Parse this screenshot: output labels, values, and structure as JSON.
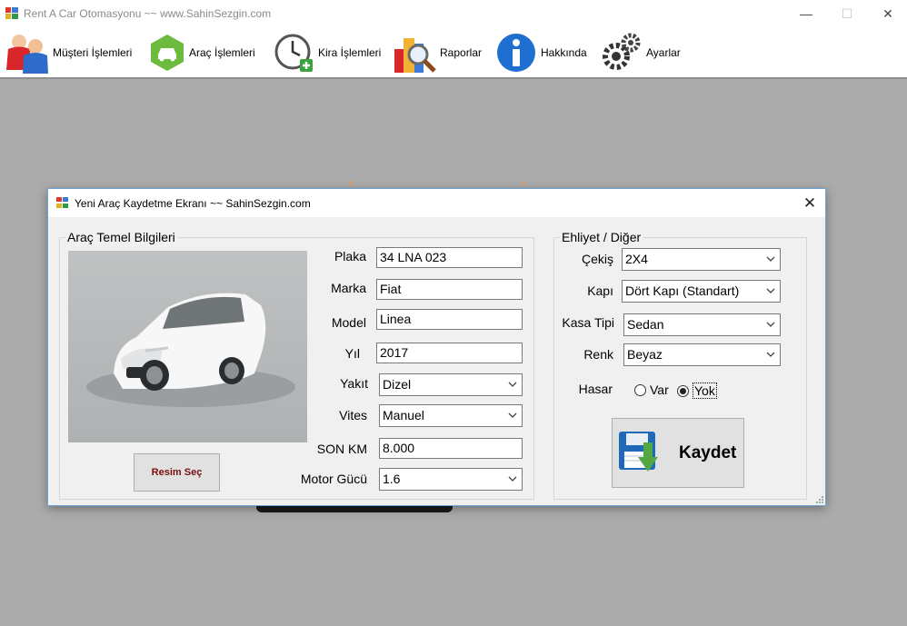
{
  "app": {
    "title": "Rent A Car Otomasyonu ~~ www.SahinSezgin.com",
    "window_controls": {
      "minimize": "—",
      "maximize": "☐",
      "close": "✕"
    }
  },
  "menu": {
    "items": [
      {
        "label": "Müşteri İşlemleri",
        "icon": "customers-icon"
      },
      {
        "label": "Araç İşlemleri",
        "icon": "car-icon"
      },
      {
        "label": "Kira İşlemleri",
        "icon": "clock-add-icon"
      },
      {
        "label": "Raporlar",
        "icon": "report-icon"
      },
      {
        "label": "Hakkında",
        "icon": "info-icon"
      },
      {
        "label": "Ayarlar",
        "icon": "gears-icon"
      }
    ]
  },
  "dialog": {
    "title": "Yeni Araç Kaydetme Ekranı ~~ SahinSezgin.com",
    "close": "✕",
    "basic_group": {
      "legend": "Araç Temel Bilgileri",
      "photo": "white Fiat Linea sedan photo",
      "select_image_button": "Resim Seç",
      "fields": {
        "plaka": {
          "label": "Plaka",
          "value": "34 LNA 023"
        },
        "marka": {
          "label": "Marka",
          "value": "Fiat"
        },
        "model": {
          "label": "Model",
          "value": "Linea"
        },
        "yil": {
          "label": "Yıl",
          "value": "2017"
        },
        "yakit": {
          "label": "Yakıt",
          "value": "Dizel"
        },
        "vites": {
          "label": "Vites",
          "value": "Manuel"
        },
        "son_km": {
          "label": "SON KM",
          "value": "8.000"
        },
        "motor": {
          "label": "Motor Gücü",
          "value": "1.6"
        }
      }
    },
    "other_group": {
      "legend": "Ehliyet / Diğer",
      "fields": {
        "cekis": {
          "label": "Çekiş",
          "value": "2X4"
        },
        "kapi": {
          "label": "Kapı",
          "value": "Dört Kapı (Standart)"
        },
        "kasa": {
          "label": "Kasa Tipi",
          "value": "Sedan"
        },
        "renk": {
          "label": "Renk",
          "value": "Beyaz"
        }
      },
      "hasar": {
        "label": "Hasar",
        "options": [
          "Var",
          "Yok"
        ],
        "selected": "Yok"
      },
      "save_button": "Kaydet"
    }
  },
  "colors": {
    "accent": "#6da3d6",
    "background": "#ababab",
    "dialog": "#f0f0f0",
    "resim_text": "#7a0e0e"
  }
}
